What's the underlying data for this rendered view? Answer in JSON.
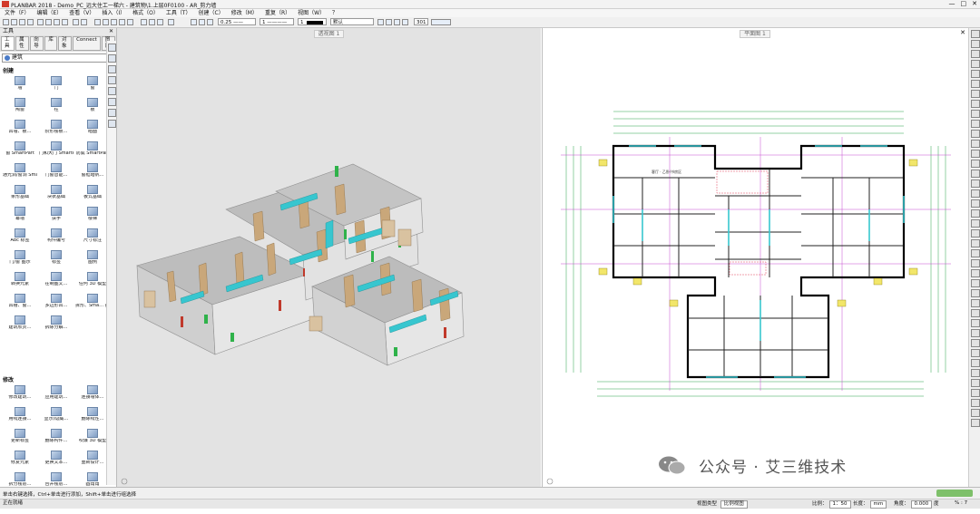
{
  "window": {
    "title": "PLANBAR 2018 - Demo_PC_远大住工一梯六 - 建筑物\\1.上层0F0100 - AR_剪力墙"
  },
  "menu": [
    "文件（F）",
    "编辑（E）",
    "查看（V）",
    "插入（I）",
    "格式（O）",
    "工具（T）",
    "创建（C）",
    "修改（M）",
    "重复（R）",
    "视图（W）",
    "？"
  ],
  "toolbar": {
    "pen": "0.25 ——",
    "line": "1 ————",
    "color": "1",
    "layer": "默认",
    "scale": "301"
  },
  "left_panel": {
    "title": "工具",
    "tabs": [
      "工具",
      "属性",
      "向导",
      "库",
      "对象",
      "Connect",
      "图层"
    ],
    "filter": "建筑",
    "section_create": "创建",
    "create_items": [
      "墙",
      "门",
      "窗",
      "陶窗",
      "柱",
      "板",
      "凹墙、板…",
      "阶形楼板…",
      "暗面",
      "窗 SmartPart",
      "门和大门 SmartPart",
      "防腐 SmartPart",
      "通光洞/窗洞 SmartPart",
      "门窗智能…",
      "窗框暗帆…",
      "条形基础",
      "块状基础",
      "板式基础",
      "幕墙",
      "扶手",
      "楼梯",
      "Abc 标签",
      "构件编号",
      "尺寸标注",
      "门/窗 图示",
      "标签",
      "图例",
      "转换元素",
      "在制图文…",
      "任何 3D 模型",
      "凹槽、窗…",
      "多边形凹…",
      "拆形、Sma… 插入副…",
      "建筑欣赏…",
      "拆除分解…"
    ],
    "section_modify": "修改",
    "modify_items": [
      "修改建筑…",
      "应用建筑…",
      "连接墙体…",
      "用线连接…",
      "显示/隐藏…",
      "删除线性…",
      "更新标签",
      "删除构件…",
      "吹爆 3D 模型",
      "修复元素",
      "更换文本…",
      "重新设计…",
      "拆分楼层…",
      "合并楼层…",
      "圆角角",
      "更换物、L…",
      "翻转智能…"
    ]
  },
  "views": {
    "left_title": "透视图 1",
    "right_title": "平面图 1"
  },
  "plan": {
    "room_label": "客厅 · 乙卧/书房区"
  },
  "status": {
    "hint": "单击右键选择，Ctrl+单击进行添加，Shift+单击进行组选择",
    "bottom_left": "正在就绪",
    "viewtype": "视图类型",
    "viewtype_value": "比例视图",
    "scale_label": "比例：",
    "scale_value": "1：50",
    "length_label": "长度：",
    "length_value": "mm",
    "angle_label": "角度：",
    "angle_value": "0.000",
    "unit": "度",
    "zoom": "% : 7"
  },
  "watermark": "公众号 · 艾三维技术",
  "colors": {
    "wall": "#c9a77a",
    "glass": "#37c6cf",
    "accent": "#d23a2b"
  }
}
